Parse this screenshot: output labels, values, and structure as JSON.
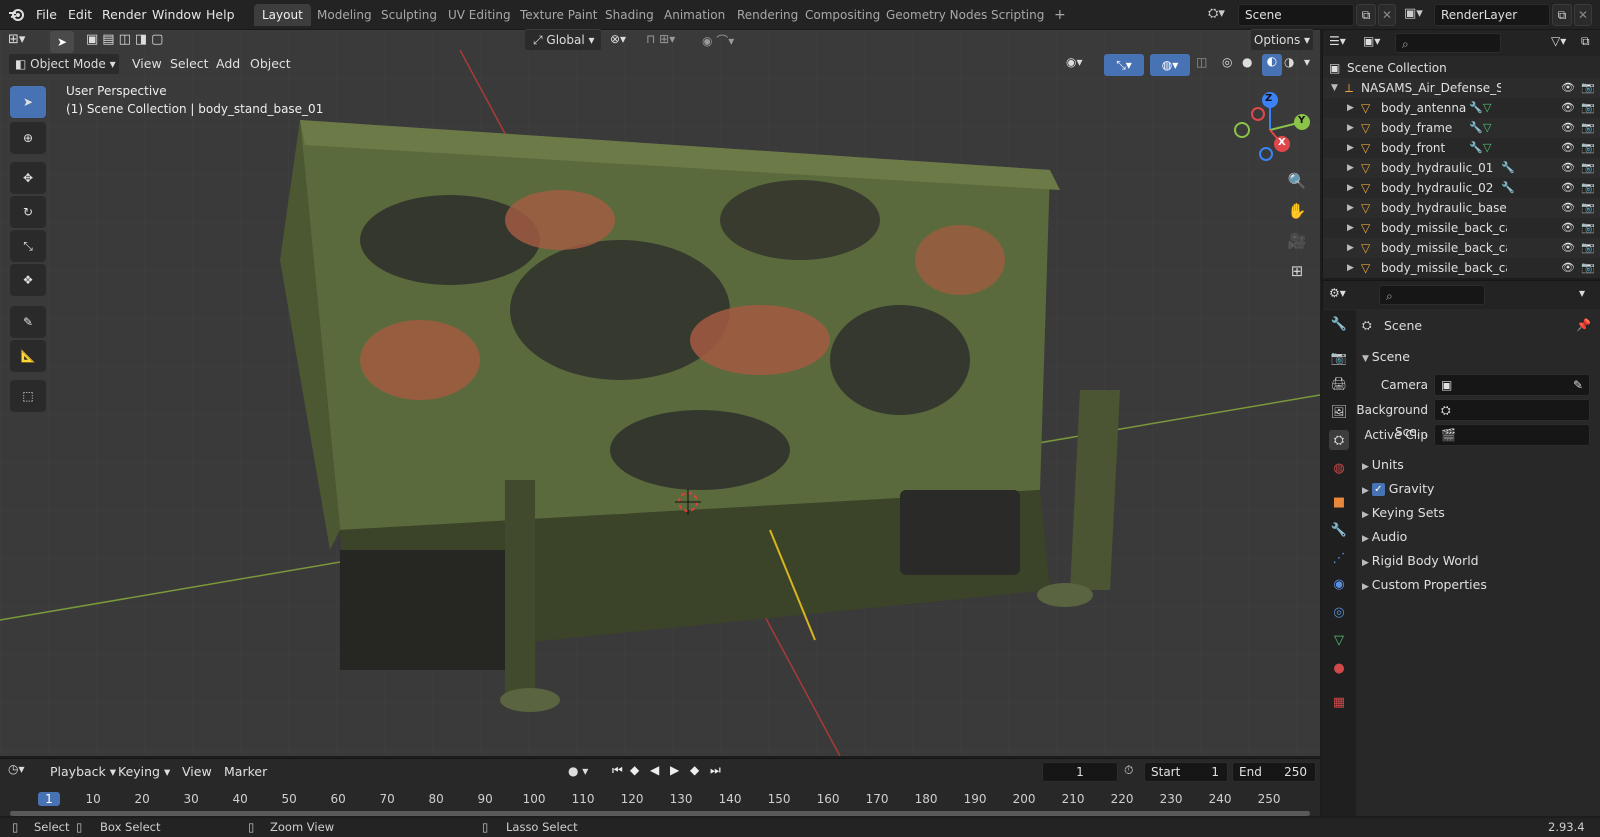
{
  "app_logo": "blender-logo",
  "menus": [
    "File",
    "Edit",
    "Render",
    "Window",
    "Help"
  ],
  "workspaces": [
    "Layout",
    "Modeling",
    "Sculpting",
    "UV Editing",
    "Texture Paint",
    "Shading",
    "Animation",
    "Rendering",
    "Compositing",
    "Geometry Nodes",
    "Scripting"
  ],
  "active_workspace": "Layout",
  "scene_field": "Scene",
  "renderlayer_field": "RenderLayer",
  "viewport": {
    "transform_orientation": "Global",
    "options_label": "Options",
    "mode": "Object Mode",
    "header_menus": [
      "View",
      "Select",
      "Add",
      "Object"
    ],
    "perspective_label": "User Perspective",
    "collection_info": "(1) Scene Collection | body_stand_base_01",
    "gizmo_axes": {
      "z": "Z",
      "y": "Y",
      "x": "X"
    }
  },
  "outliner": {
    "root": "Scene Collection",
    "collection": "NASAMS_Air_Defense_Syster",
    "items": [
      "body_antenna",
      "body_frame",
      "body_front",
      "body_hydraulic_01",
      "body_hydraulic_02",
      "body_hydraulic_base",
      "body_missile_back_cap_(",
      "body_missile_back_cap_(",
      "body_missile_back_cap_("
    ]
  },
  "properties": {
    "context": "Scene",
    "panel": "Scene",
    "fields": [
      {
        "label": "Camera",
        "value": ""
      },
      {
        "label": "Background Sce...",
        "value": ""
      },
      {
        "label": "Active Clip",
        "value": ""
      }
    ],
    "sections": [
      "Units",
      "Gravity",
      "Keying Sets",
      "Audio",
      "Rigid Body World",
      "Custom Properties"
    ],
    "gravity_checked": true
  },
  "timeline": {
    "menus": [
      "Playback",
      "Keying",
      "View",
      "Marker"
    ],
    "current_frame": "1",
    "start_label": "Start",
    "start_value": "1",
    "end_label": "End",
    "end_value": "250",
    "ticks": [
      "1",
      "10",
      "20",
      "30",
      "40",
      "50",
      "60",
      "70",
      "80",
      "90",
      "100",
      "110",
      "120",
      "130",
      "140",
      "150",
      "160",
      "170",
      "180",
      "190",
      "200",
      "210",
      "220",
      "230",
      "240",
      "250"
    ]
  },
  "statusbar": {
    "select": "Select",
    "box_select": "Box Select",
    "zoom_view": "Zoom View",
    "lasso_select": "Lasso Select",
    "version": "2.93.4"
  },
  "colors": {
    "accent": "#4772b3",
    "header": "#232323",
    "panel": "#282828",
    "viewport": "#3a3a3a",
    "x_axis": "#e0474c",
    "y_axis": "#8bc34a",
    "z_axis": "#3b82f6"
  }
}
